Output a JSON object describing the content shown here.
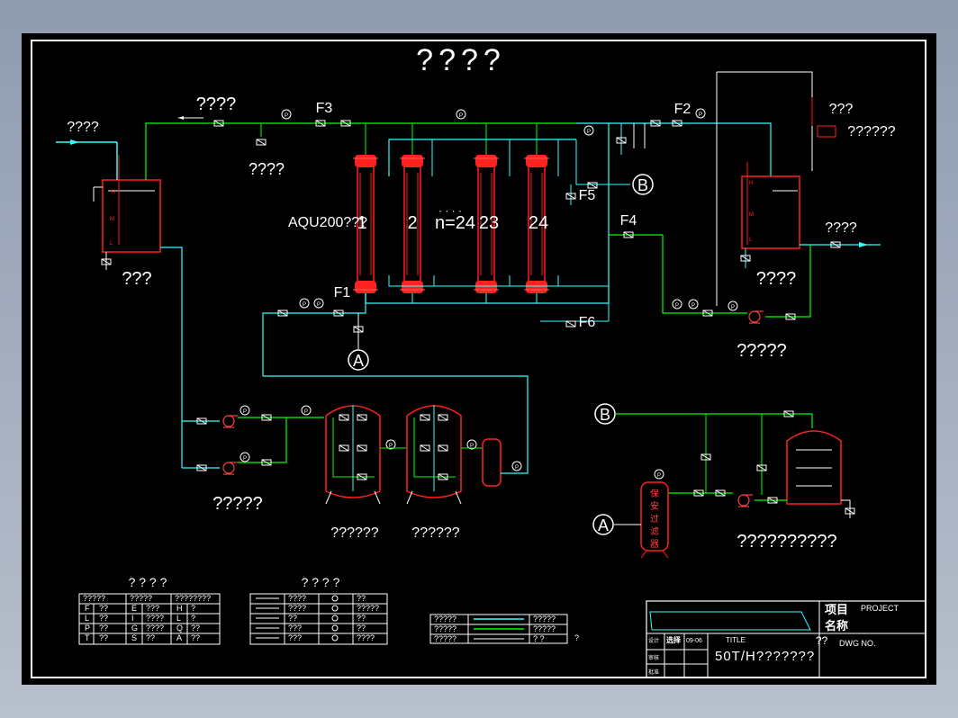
{
  "drawing": {
    "main_title": "????",
    "title_block": {
      "project_cn": "项目",
      "project_en": "PROJECT",
      "name_cn": "名称",
      "dwg_prefix": "??",
      "dwg_no": "DWG NO.",
      "title_label": "TITLE",
      "title": "50T/H???????",
      "date": "09-06",
      "row1": "设计",
      "row1b": "选择",
      "row2": "审核",
      "row3": "批准"
    }
  },
  "labels": {
    "inlet": "????",
    "concentrate_out": "????",
    "drain": "????",
    "raw_tank": "???",
    "membrane_model": "AQU200???",
    "unit_1": "1",
    "unit_2": "2",
    "unit_dots": "· · · ·",
    "unit_n": "n=24",
    "unit_23": "23",
    "unit_24": "24",
    "F1": "F1",
    "F2": "F2",
    "F3": "F3",
    "F4": "F4",
    "F5": "F5",
    "F6": "F6",
    "node_A": "A",
    "node_B": "B",
    "dosing_a": "???",
    "dosing_b": "??????",
    "product_out": "????",
    "product_tank": "????",
    "product_pump": "?????",
    "feed_pumps": "?????",
    "sand_filter": "??????",
    "carbon_filter": "??????",
    "cip_system": "??????????",
    "security_filter_chars": [
      "保",
      "安",
      "过",
      "滤",
      "器"
    ]
  },
  "legend_left": {
    "title": "? ? ? ?",
    "header": [
      "?????",
      "?????",
      "????????"
    ],
    "rows": [
      [
        "F",
        "??",
        "E",
        "???",
        "H",
        "?"
      ],
      [
        "L",
        "??",
        "I",
        "????",
        "L",
        "?"
      ],
      [
        "P",
        "??",
        "G",
        "????",
        "Q",
        "??"
      ],
      [
        "T",
        "??",
        "S",
        "??",
        "A",
        "??"
      ]
    ]
  },
  "legend_mid": {
    "title": "? ? ? ?",
    "rows": [
      [
        "????",
        "??"
      ],
      [
        "????",
        "?????"
      ],
      [
        "??",
        "??"
      ],
      [
        "???",
        "??"
      ],
      [
        "???",
        "????"
      ]
    ]
  },
  "legend_lines": {
    "rows": [
      [
        "?????",
        "?????"
      ],
      [
        "?????",
        "?????"
      ],
      [
        "?????",
        "?  ?"
      ]
    ],
    "extra": "?"
  },
  "colors": {
    "background": "#000000",
    "pipe_water": "#33ffff",
    "pipe_main": "#00ff00",
    "equipment": "#ff2020",
    "text": "#ffffff",
    "frame": "#ffffff"
  }
}
